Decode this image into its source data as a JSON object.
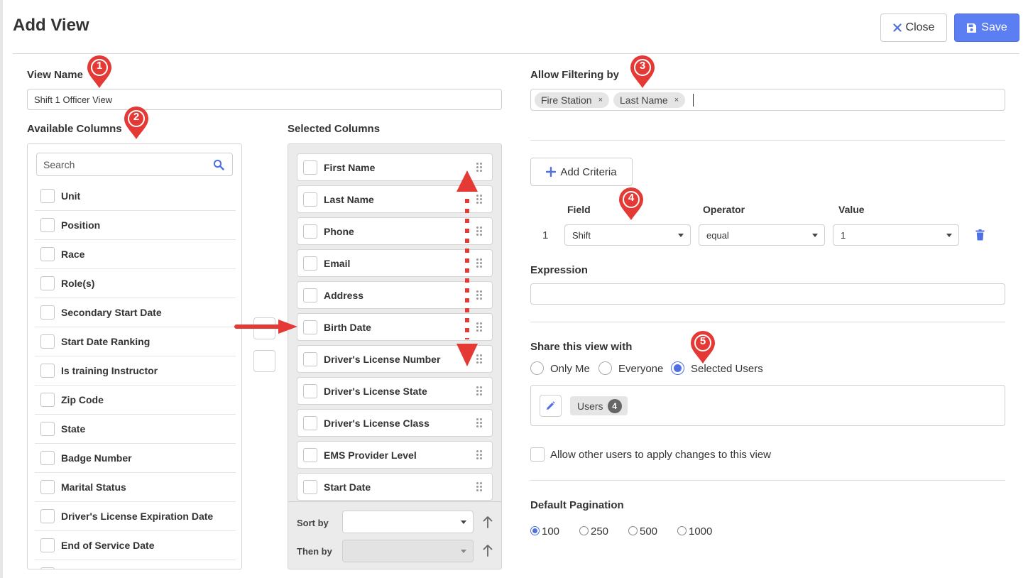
{
  "header": {
    "title": "Add View",
    "close_label": "Close",
    "save_label": "Save"
  },
  "view_name": {
    "label": "View Name",
    "value": "Shift 1 Officer View"
  },
  "available_columns": {
    "label": "Available Columns",
    "search_placeholder": "Search",
    "items": [
      "Unit",
      "Position",
      "Race",
      "Role(s)",
      "Secondary Start Date",
      "Start Date Ranking",
      "Is training Instructor",
      "Zip Code",
      "State",
      "Badge Number",
      "Marital Status",
      "Driver's License Expiration Date",
      "End of Service Date"
    ]
  },
  "selected_columns": {
    "label": "Selected Columns",
    "items": [
      "First Name",
      "Last Name",
      "Phone",
      "Email",
      "Address",
      "Birth Date",
      "Driver's License Number",
      "Driver's License State",
      "Driver's License Class",
      "EMS Provider Level",
      "Start Date"
    ],
    "sort_by_label": "Sort by",
    "then_by_label": "Then by"
  },
  "filtering": {
    "label": "Allow Filtering by",
    "tags": [
      "Fire Station",
      "Last Name"
    ],
    "add_criteria_label": "Add Criteria",
    "columns": {
      "field": "Field",
      "operator": "Operator",
      "value": "Value"
    },
    "row": {
      "index": "1",
      "field": "Shift",
      "operator": "equal",
      "value": "1"
    }
  },
  "expression": {
    "label": "Expression",
    "value": ""
  },
  "share": {
    "label": "Share this view with",
    "options": [
      "Only Me",
      "Everyone",
      "Selected Users"
    ],
    "selected": "Selected Users",
    "users_label": "Users",
    "users_count": "4",
    "allow_changes_label": "Allow other users to apply changes to this view"
  },
  "pagination": {
    "label": "Default Pagination",
    "options": [
      "100",
      "250",
      "500",
      "1000"
    ],
    "selected": "100"
  },
  "annotations": [
    "1",
    "2",
    "3",
    "4",
    "5"
  ],
  "colors": {
    "primary": "#5b7ef2",
    "annotation": "#e53935",
    "panel_bg": "#ebebeb"
  }
}
